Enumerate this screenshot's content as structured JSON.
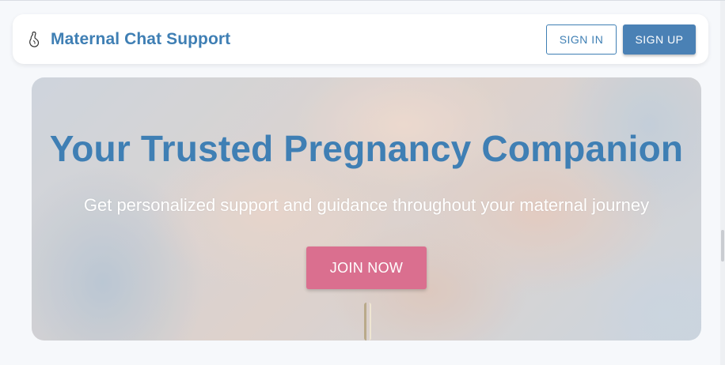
{
  "header": {
    "brand_icon": "pregnant-silhouette-icon",
    "title": "Maternal Chat Support",
    "sign_in_label": "SIGN IN",
    "sign_up_label": "SIGN UP"
  },
  "hero": {
    "background_image": "hands-holding-photo",
    "title": "Your Trusted Pregnancy Companion",
    "subtitle": "Get personalized support and guidance throughout your maternal journey",
    "cta_label": "JOIN NOW"
  },
  "colors": {
    "primary": "#3f7fb4",
    "accent": "#da6f8f",
    "background": "#f6f8fb"
  }
}
